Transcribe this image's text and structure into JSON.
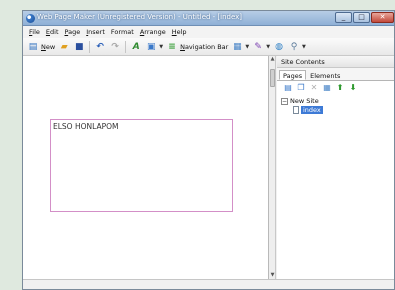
{
  "window": {
    "title": "Web Page Maker (Unregistered Version) - Untitled - [index]"
  },
  "window_controls": {
    "minimize": "_",
    "maximize": "□",
    "close": "✕"
  },
  "menu": [
    {
      "label": "File",
      "key": "F",
      "rest": "ile"
    },
    {
      "label": "Edit",
      "key": "E",
      "rest": "dit"
    },
    {
      "label": "Page",
      "key": "P",
      "rest": "age"
    },
    {
      "label": "Insert",
      "key": "I",
      "rest": "nsert"
    },
    {
      "label": "Format",
      "key": "",
      "rest": "Format"
    },
    {
      "label": "Arrange",
      "key": "A",
      "rest": "rrange"
    },
    {
      "label": "Help",
      "key": "H",
      "rest": "elp"
    }
  ],
  "toolbar": {
    "new_label": "New",
    "new_key": "N",
    "new_rest": "ew",
    "navigation_bar_label": "Navigation Bar",
    "navigation_bar_key": "N",
    "navigation_bar_rest": "avigation Bar"
  },
  "editor": {
    "heading": "ELSO HONLAPOM"
  },
  "side_panel": {
    "title": "Site Contents",
    "tabs": [
      "Pages",
      "Elements"
    ],
    "tree": {
      "root": "New Site",
      "child": "index"
    }
  },
  "colors": {
    "accent": "#3d7ad6",
    "frame_border": "#d38fc7"
  }
}
